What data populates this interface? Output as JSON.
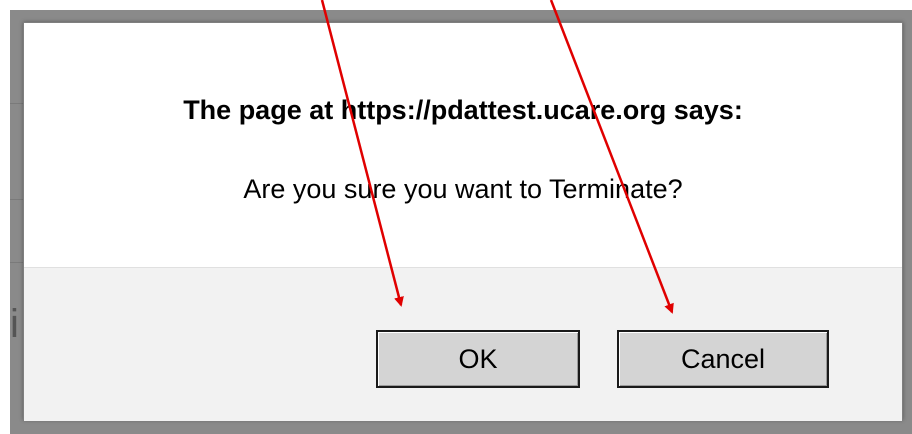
{
  "dialog": {
    "title": "The page at https://pdattest.ucare.org says:",
    "message": "Are you sure you want to Terminate?",
    "ok_label": "OK",
    "cancel_label": "Cancel"
  },
  "colors": {
    "arrow": "#e00000",
    "backdrop": "#8a8a8a",
    "footer": "#f2f2f2",
    "button": "#d4d4d4"
  }
}
